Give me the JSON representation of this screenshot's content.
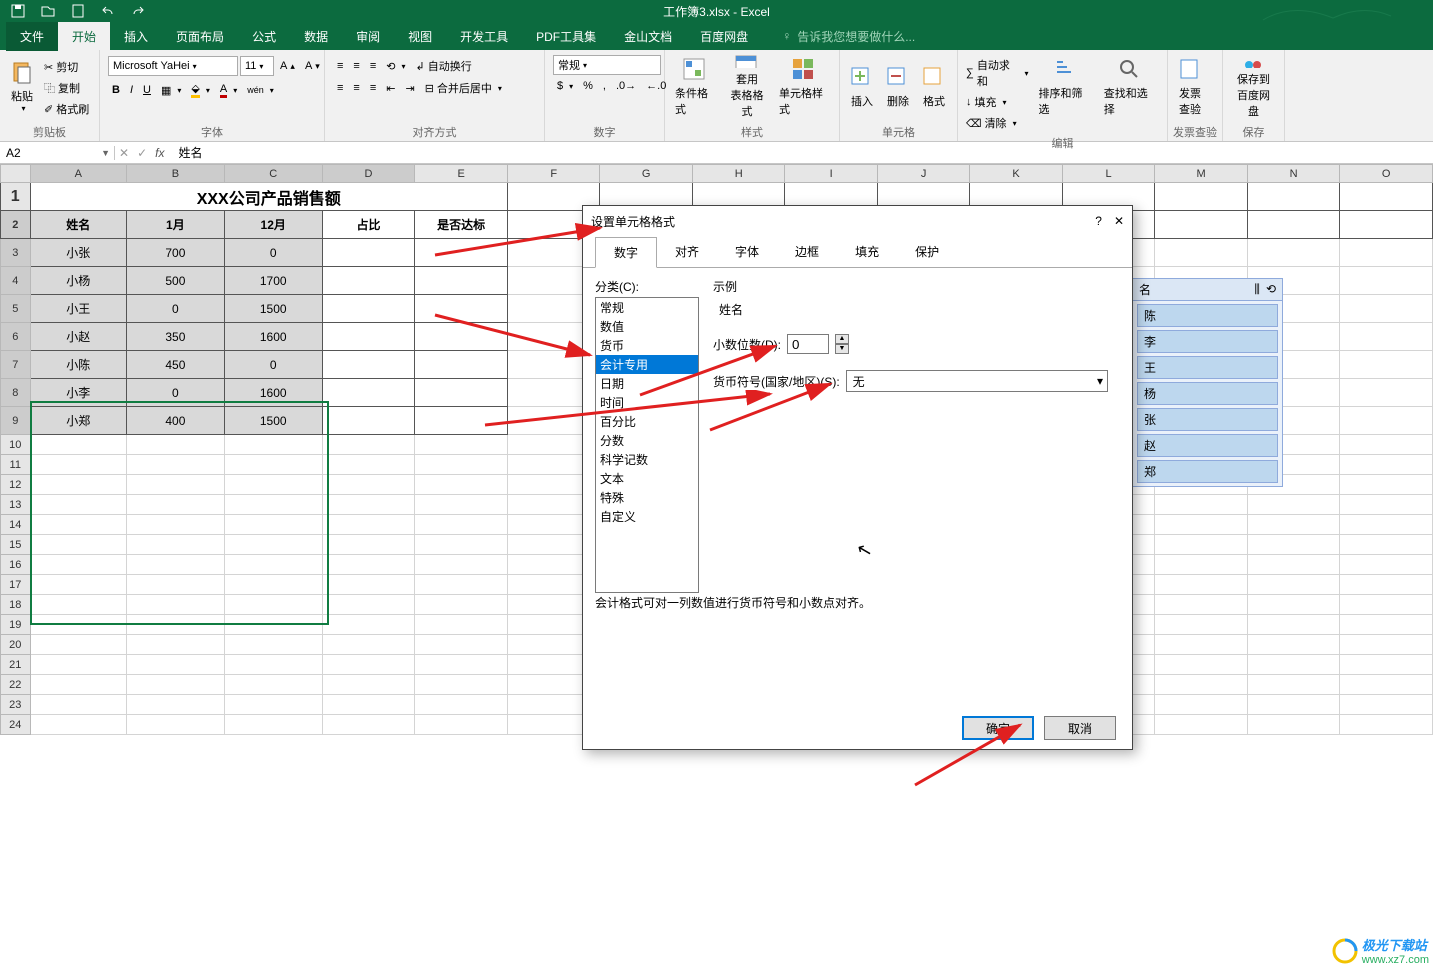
{
  "app": {
    "title": "工作簿3.xlsx - Excel"
  },
  "qat": [
    "save",
    "open",
    "new",
    "undo",
    "redo"
  ],
  "menu": {
    "file": "文件",
    "items": [
      "开始",
      "插入",
      "页面布局",
      "公式",
      "数据",
      "审阅",
      "视图",
      "开发工具",
      "PDF工具集",
      "金山文档",
      "百度网盘"
    ],
    "active": "开始",
    "tell_me": "告诉我您想要做什么..."
  },
  "ribbon": {
    "clipboard": {
      "label": "剪贴板",
      "paste": "粘贴",
      "cut": "剪切",
      "copy": "复制",
      "painter": "格式刷"
    },
    "font": {
      "label": "字体",
      "name": "Microsoft YaHei",
      "size": "11",
      "bold": "B",
      "italic": "I",
      "underline": "U"
    },
    "align": {
      "label": "对齐方式",
      "wrap": "自动换行",
      "merge": "合并后居中"
    },
    "number": {
      "label": "数字",
      "format": "常规"
    },
    "styles": {
      "label": "样式",
      "cond": "条件格式",
      "table": "套用\n表格格式",
      "cell": "单元格样式"
    },
    "cells": {
      "label": "单元格",
      "insert": "插入",
      "delete": "删除",
      "format": "格式"
    },
    "editing": {
      "label": "编辑",
      "sum": "自动求和",
      "fill": "填充",
      "clear": "清除",
      "sort": "排序和筛选",
      "find": "查找和选择"
    },
    "invoice": {
      "label": "发票查验",
      "btn": "发票\n查验"
    },
    "baidu": {
      "label": "保存",
      "btn": "保存到\n百度网盘"
    }
  },
  "formula": {
    "cell_ref": "A2",
    "value": "姓名"
  },
  "sheet": {
    "columns": [
      "",
      "A",
      "B",
      "C",
      "D",
      "E",
      "F",
      "G",
      "H",
      "I",
      "J",
      "K",
      "L",
      "M",
      "N",
      "O"
    ],
    "title": "XXX公司产品销售额",
    "headers": [
      "姓名",
      "1月",
      "12月",
      "占比",
      "是否达标"
    ],
    "rows": [
      [
        "小张",
        "700",
        "0",
        "",
        ""
      ],
      [
        "小杨",
        "500",
        "1700",
        "",
        ""
      ],
      [
        "小王",
        "0",
        "1500",
        "",
        ""
      ],
      [
        "小赵",
        "350",
        "1600",
        "",
        ""
      ],
      [
        "小陈",
        "450",
        "0",
        "",
        ""
      ],
      [
        "小李",
        "0",
        "1600",
        "",
        ""
      ],
      [
        "小郑",
        "400",
        "1500",
        "",
        ""
      ]
    ]
  },
  "dialog": {
    "title": "设置单元格格式",
    "tabs": [
      "数字",
      "对齐",
      "字体",
      "边框",
      "填充",
      "保护"
    ],
    "active_tab": "数字",
    "category_label": "分类(C):",
    "categories": [
      "常规",
      "数值",
      "货币",
      "会计专用",
      "日期",
      "时间",
      "百分比",
      "分数",
      "科学记数",
      "文本",
      "特殊",
      "自定义"
    ],
    "selected_category": "会计专用",
    "sample_label": "示例",
    "sample_value": "姓名",
    "decimal_label": "小数位数(D):",
    "decimal_value": "0",
    "currency_label": "货币符号(国家/地区)(S):",
    "currency_value": "无",
    "description": "会计格式可对一列数值进行货币符号和小数点对齐。",
    "ok": "确定",
    "cancel": "取消"
  },
  "filter": {
    "header": "名",
    "items": [
      "陈",
      "李",
      "王",
      "杨",
      "张",
      "赵",
      "郑"
    ]
  },
  "watermark": {
    "brand": "极光下载站",
    "url": "www.xz7.com"
  }
}
